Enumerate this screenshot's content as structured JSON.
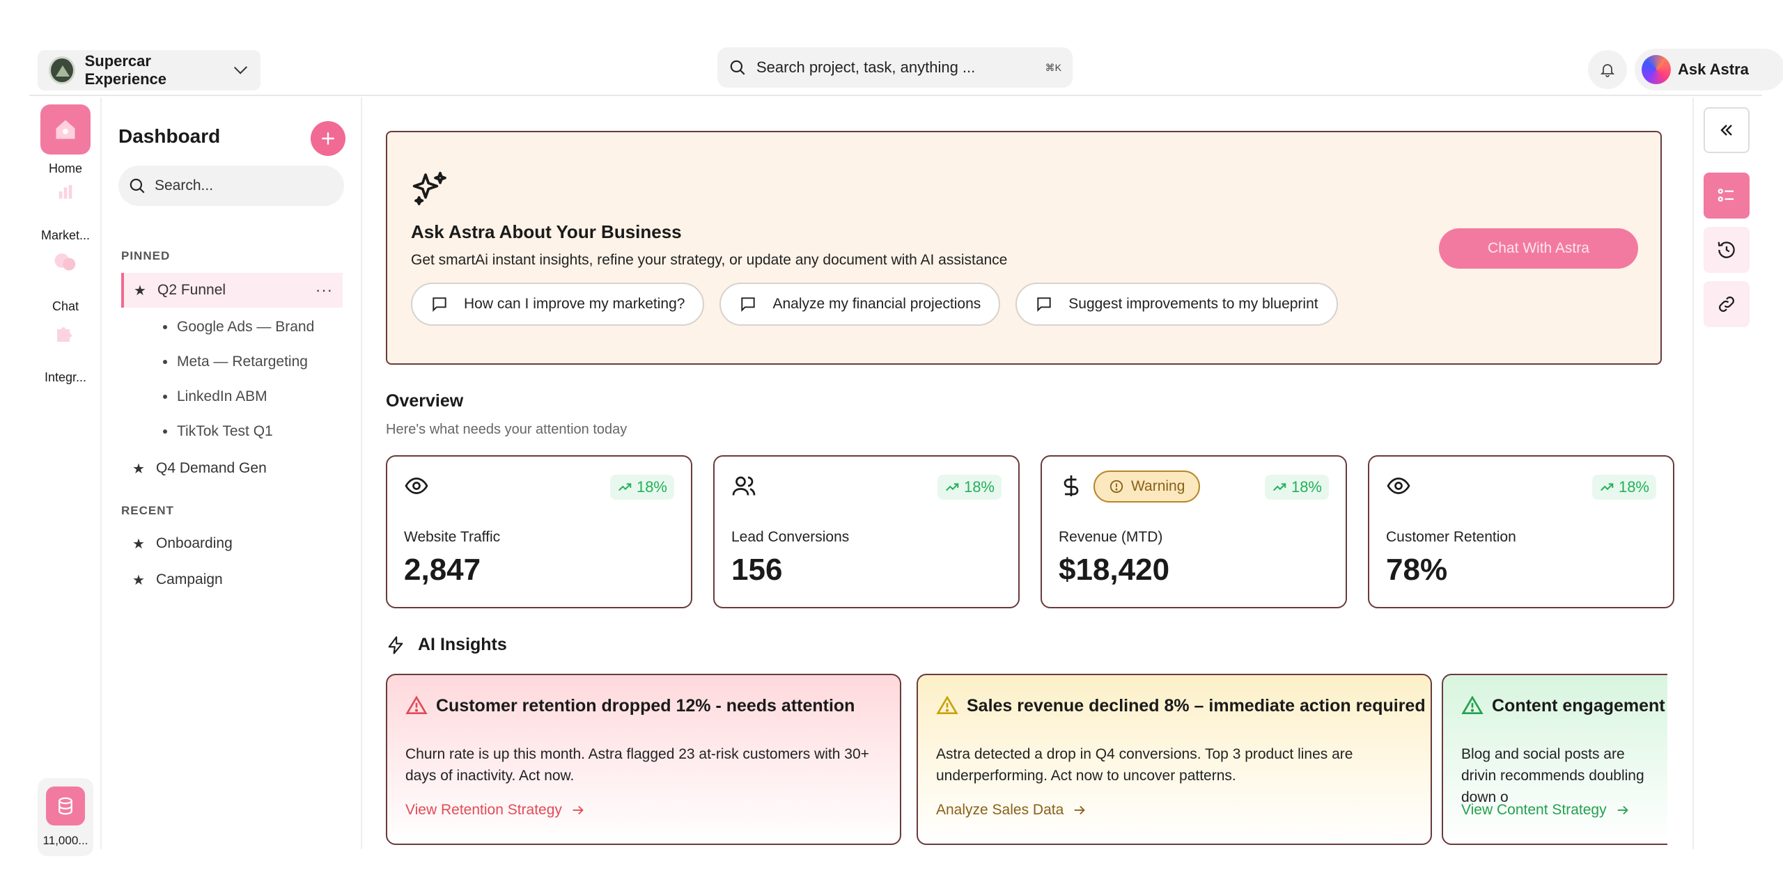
{
  "header": {
    "workspace_name": "Supercar Experience",
    "search_placeholder": "Search project, task, anything ...",
    "search_shortcut": "⌘K",
    "ask_label": "Ask Astra"
  },
  "rail": {
    "items": [
      {
        "label": "Home",
        "icon": "home-icon"
      },
      {
        "label": "Market...",
        "icon": "chart-icon"
      },
      {
        "label": "Chat",
        "icon": "chat-icon"
      },
      {
        "label": "Integr...",
        "icon": "puzzle-icon"
      }
    ],
    "bottom_count": "11,000..."
  },
  "sidebar": {
    "title": "Dashboard",
    "search_placeholder": "Search...",
    "pinned_label": "PINNED",
    "pinned": [
      {
        "label": "Q2 Funnel",
        "children": [
          "Google Ads — Brand",
          "Meta — Retargeting",
          "LinkedIn ABM",
          "TikTok Test Q1"
        ]
      },
      {
        "label": "Q4 Demand Gen"
      }
    ],
    "more": "···",
    "recent_label": "RECENT",
    "recent": [
      "Onboarding",
      "Campaign"
    ]
  },
  "hero": {
    "title": "Ask Astra About Your Business",
    "subtitle": "Get smartAi instant insights, refine your strategy, or update any document with AI assistance",
    "prompts": [
      "How can I improve my marketing?",
      "Analyze my financial projections",
      "Suggest improvements to my blueprint"
    ],
    "cta": "Chat With Astra"
  },
  "overview": {
    "title": "Overview",
    "subtitle": "Here's what needs your attention today",
    "kpis": [
      {
        "label": "Website Traffic",
        "value": "2,847",
        "trend": "18%",
        "icon": "eye-icon"
      },
      {
        "label": "Lead Conversions",
        "value": "156",
        "trend": "18%",
        "icon": "users-icon"
      },
      {
        "label": "Revenue (MTD)",
        "value": "$18,420",
        "trend": "18%",
        "icon": "dollar-icon",
        "badge": "Warning"
      },
      {
        "label": "Customer Retention",
        "value": "78%",
        "trend": "18%",
        "icon": "eye-icon"
      }
    ]
  },
  "insights": {
    "title": "AI Insights",
    "cards": [
      {
        "title": "Customer retention dropped 12% - needs attention",
        "body": "Churn rate is up this month. Astra flagged 23 at-risk customers with 30+ days of inactivity. Act now.",
        "link": "View Retention Strategy",
        "color": "#e24b57"
      },
      {
        "title": "Sales revenue declined 8% – immediate action required",
        "body": "Astra detected a drop in Q4 conversions. Top 3 product lines are underperforming. Act now to uncover patterns.",
        "link": "Analyze Sales Data",
        "color": "#c9a20a"
      },
      {
        "title": "Content engagement",
        "body": "Blog and social posts are drivin recommends doubling down o",
        "link": "View Content Strategy",
        "color": "#23a04f"
      }
    ]
  },
  "colors": {
    "accent": "#f27aa0",
    "positive": "#22b15a",
    "border": "#6b3a3a"
  }
}
